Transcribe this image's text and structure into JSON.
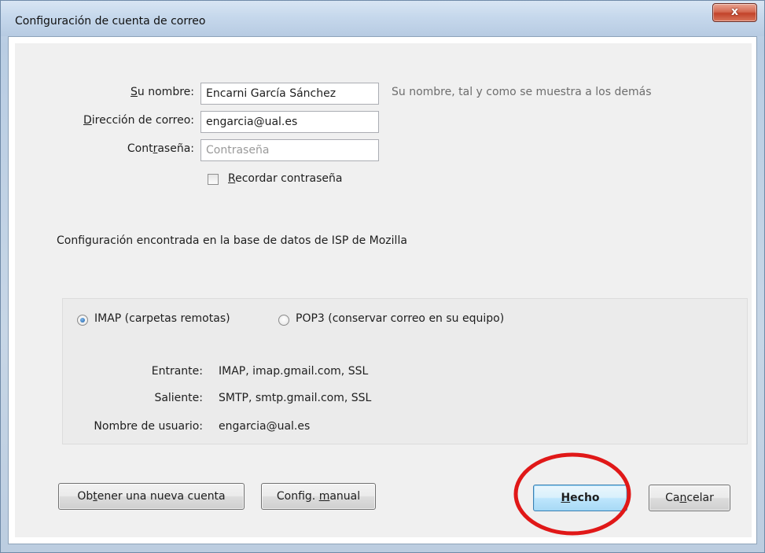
{
  "window": {
    "title": "Configuración de cuenta de correo",
    "close_glyph": "x"
  },
  "form": {
    "name_label": "Su nombre:",
    "name_label_accel": "S",
    "name_label_rest": "u nombre:",
    "name_value": "Encarni García Sánchez",
    "name_hint": "Su nombre, tal y como se muestra a los demás",
    "email_label_accel": "D",
    "email_label_rest": "irección de correo:",
    "email_value": "engarcia@ual.es",
    "password_label_pre": "Cont",
    "password_label_accel": "r",
    "password_label_post": "aseña:",
    "password_placeholder": "Contraseña",
    "remember_accel": "R",
    "remember_rest": "ecordar contraseña",
    "remember_checked": false
  },
  "status_text": "Configuración encontrada en la base de datos de ISP de Mozilla",
  "protocol": {
    "imap_label": "IMAP (carpetas remotas)",
    "pop3_label": "POP3 (conservar correo en su equipo)",
    "selected": "imap"
  },
  "server_info": {
    "incoming_label": "Entrante:",
    "incoming_value": "IMAP, imap.gmail.com, SSL",
    "outgoing_label": "Saliente:",
    "outgoing_value": "SMTP, smtp.gmail.com, SSL",
    "username_label": "Nombre de usuario:",
    "username_value": "engarcia@ual.es"
  },
  "buttons": {
    "new_account_pre": "Ob",
    "new_account_accel": "t",
    "new_account_post": "ener una nueva cuenta",
    "manual_pre": "Config. ",
    "manual_accel": "m",
    "manual_post": "anual",
    "done_accel": "H",
    "done_rest": "echo",
    "cancel_pre": "Ca",
    "cancel_accel": "n",
    "cancel_post": "celar"
  },
  "colors": {
    "highlight_circle": "#e01818",
    "default_button_border": "#3c7fb1"
  }
}
